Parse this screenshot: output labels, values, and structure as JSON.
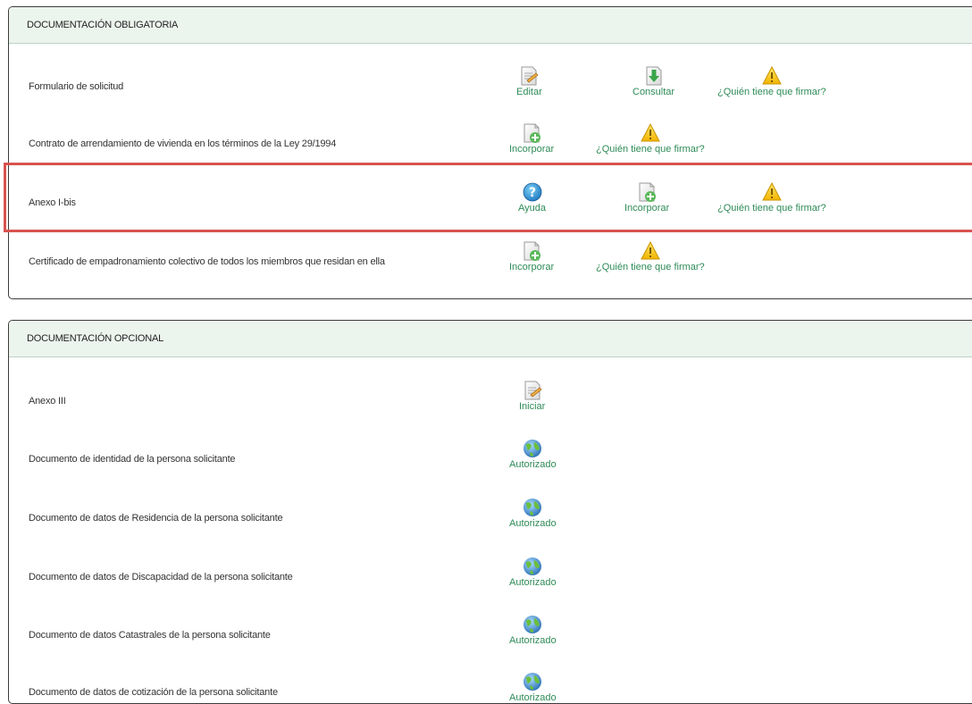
{
  "obligatoria": {
    "title": "DOCUMENTACIÓN OBLIGATORIA",
    "rows": [
      {
        "label": "Formulario de solicitud",
        "actions": [
          "Editar",
          "Consultar",
          "¿Quién tiene que firmar?"
        ]
      },
      {
        "label": "Contrato de arrendamiento de vivienda en los términos de la Ley 29/1994",
        "actions": [
          "Incorporar",
          "¿Quién tiene que firmar?"
        ]
      },
      {
        "label": "Anexo I-bis",
        "actions": [
          "Ayuda",
          "Incorporar",
          "¿Quién tiene que firmar?"
        ]
      },
      {
        "label": "Certificado de empadronamiento colectivo de todos los miembros que residan en ella",
        "actions": [
          "Incorporar",
          "¿Quién tiene que firmar?"
        ]
      }
    ]
  },
  "opcional": {
    "title": "DOCUMENTACIÓN OPCIONAL",
    "rows": [
      {
        "label": "Anexo III",
        "actions": [
          "Iniciar"
        ]
      },
      {
        "label": "Documento de identidad de la persona solicitante",
        "actions": [
          "Autorizado"
        ]
      },
      {
        "label": "Documento de datos de Residencia de la persona solicitante",
        "actions": [
          "Autorizado"
        ]
      },
      {
        "label": "Documento de datos de Discapacidad de la persona solicitante",
        "actions": [
          "Autorizado"
        ]
      },
      {
        "label": "Documento de datos Catastrales de la persona solicitante",
        "actions": [
          "Autorizado"
        ]
      },
      {
        "label": "Documento de datos de cotización de la persona solicitante",
        "actions": [
          "Autorizado"
        ]
      }
    ]
  },
  "icons": {
    "edit": "edit-document-icon",
    "download": "download-icon",
    "warning": "warning-icon",
    "add": "add-document-icon",
    "help": "help-icon",
    "globe": "authorized-globe-icon"
  },
  "colors": {
    "header_bg": "#ecf4ee",
    "action_text": "#2e8b57",
    "highlight": "#d9534f",
    "warning": "#f5c518"
  }
}
